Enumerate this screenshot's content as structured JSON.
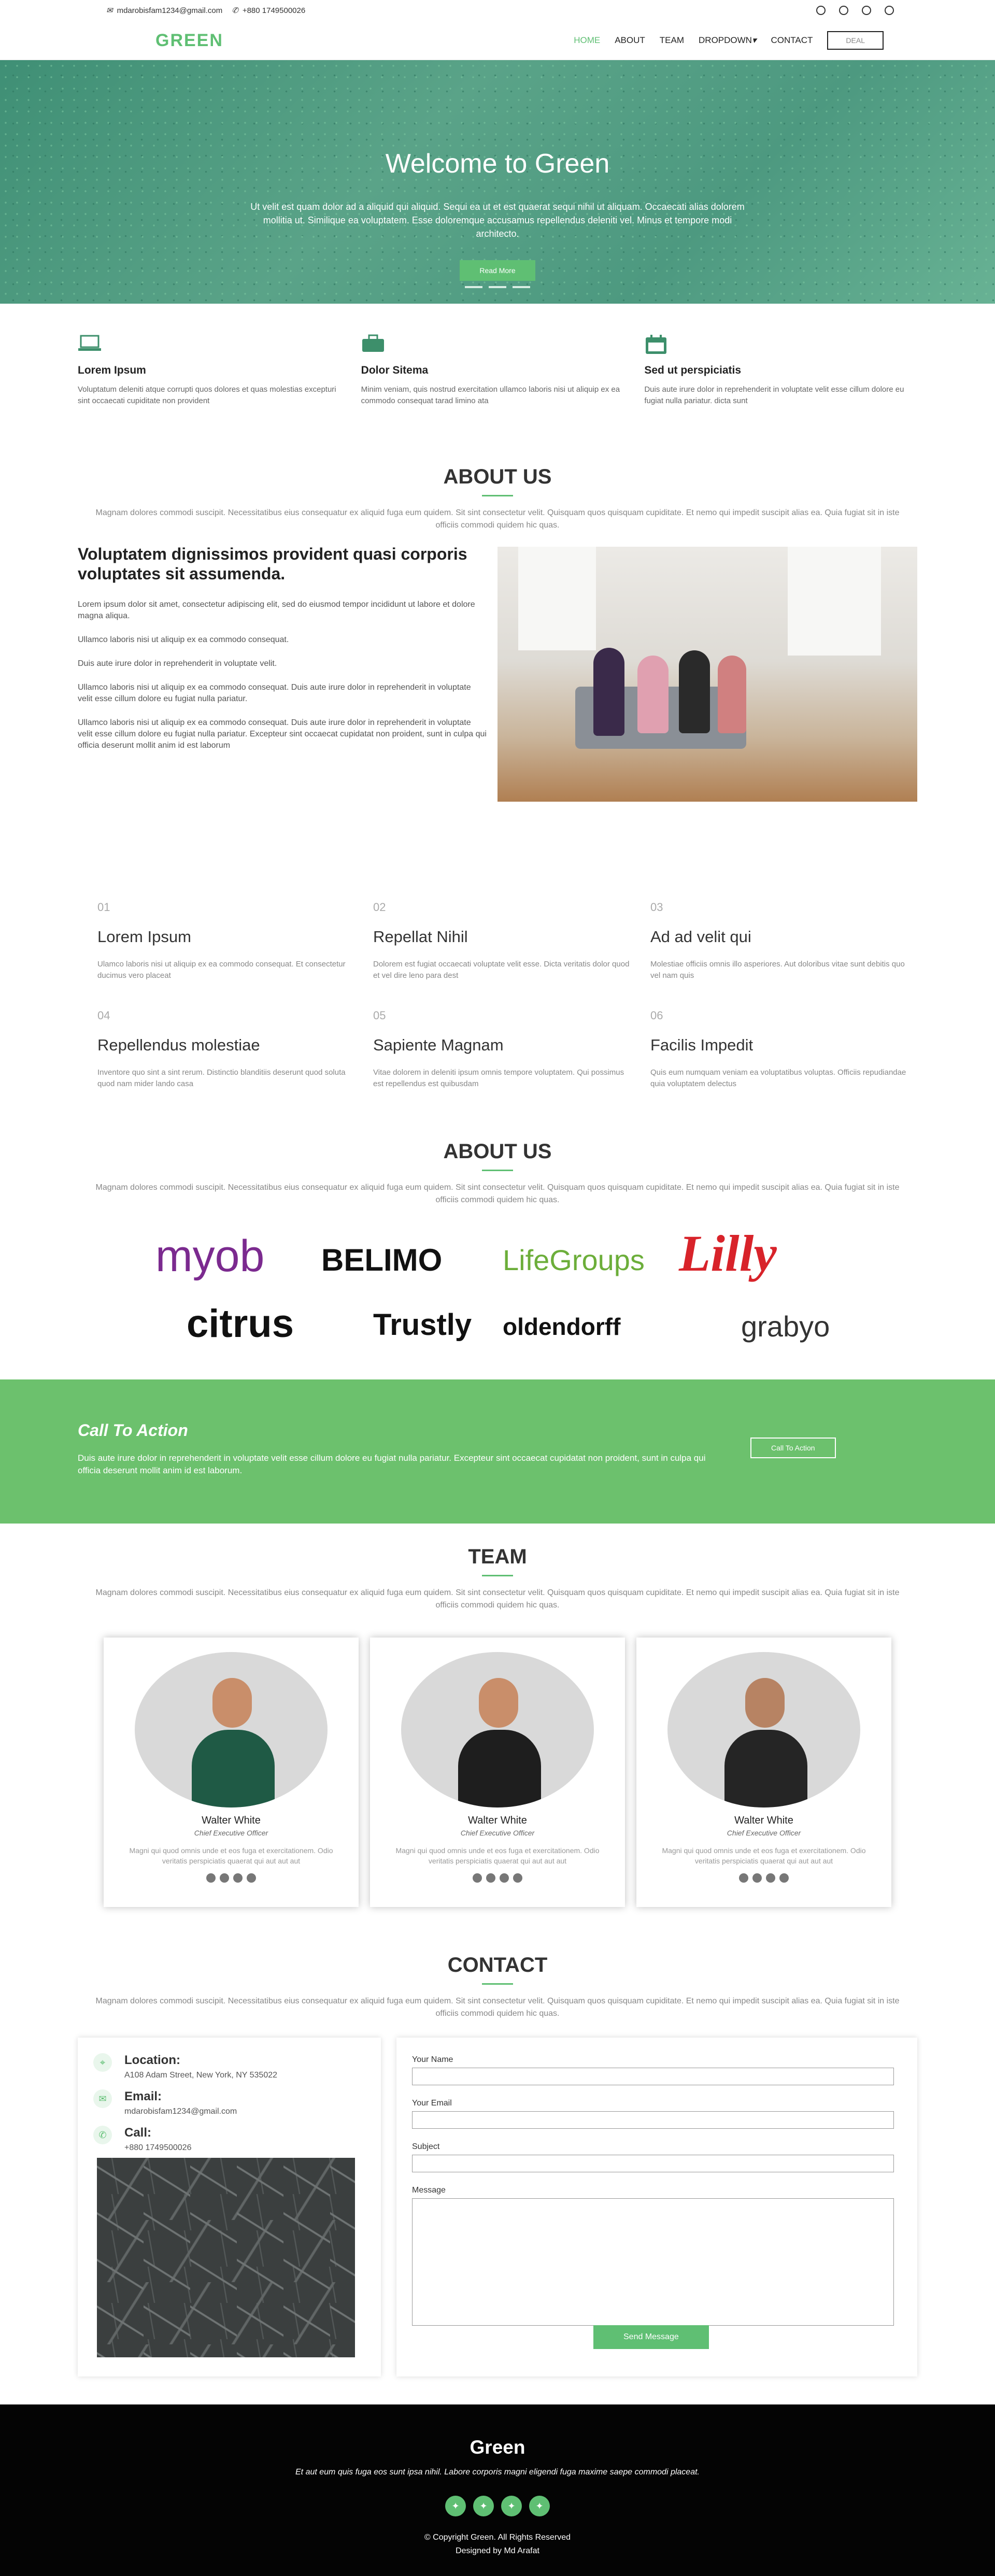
{
  "topbar": {
    "email": "mdarobisfam1234@gmail.com",
    "phone": "+880 1749500026"
  },
  "header": {
    "logo": "GREEN",
    "nav": [
      "HOME",
      "ABOUT",
      "TEAM",
      "DROPDOWN",
      "CONTACT"
    ],
    "dropdown_caret": "▾",
    "button": "DEAL"
  },
  "hero": {
    "title": "Welcome to Green",
    "text": "Ut velit est quam dolor ad a aliquid qui aliquid. Sequi ea ut et est quaerat sequi nihil ut aliquam. Occaecati alias dolorem mollitia ut. Similique ea voluptatem. Esse doloremque accusamus repellendus deleniti vel. Minus et tempore modi architecto.",
    "button": "Read More",
    "slides": 3
  },
  "features": [
    {
      "icon": "laptop-icon",
      "title": "Lorem Ipsum",
      "text": "Voluptatum deleniti atque corrupti quos dolores et quas molestias excepturi sint occaecati cupiditate non provident"
    },
    {
      "icon": "briefcase-icon",
      "title": "Dolor Sitema",
      "text": "Minim veniam, quis nostrud exercitation ullamco laboris nisi ut aliquip ex ea commodo consequat tarad limino ata"
    },
    {
      "icon": "calendar-icon",
      "title": "Sed ut perspiciatis",
      "text": "Duis aute irure dolor in reprehenderit in voluptate velit esse cillum dolore eu fugiat nulla pariatur. dicta sunt"
    }
  ],
  "about": {
    "title": "ABOUT US",
    "subtitle": "Magnam dolores commodi suscipit. Necessitatibus eius consequatur ex aliquid fuga eum quidem. Sit sint consectetur velit. Quisquam quos quisquam cupiditate. Et nemo qui impedit suscipit alias ea. Quia fugiat sit in iste officiis commodi quidem hic quas.",
    "heading": "Voluptatem dignissimos provident quasi corporis voluptates sit assumenda.",
    "paras": [
      "Lorem ipsum dolor sit amet, consectetur adipiscing elit, sed do eiusmod tempor incididunt ut labore et dolore magna aliqua.",
      "Ullamco laboris nisi ut aliquip ex ea commodo consequat.",
      "Duis aute irure dolor in reprehenderit in voluptate velit.",
      "Ullamco laboris nisi ut aliquip ex ea commodo consequat. Duis aute irure dolor in reprehenderit in voluptate velit esse cillum dolore eu fugiat nulla pariatur.",
      "Ullamco laboris nisi ut aliquip ex ea commodo consequat. Duis aute irure dolor in reprehenderit in voluptate velit esse cillum dolore eu fugiat nulla pariatur. Excepteur sint occaecat cupidatat non proident, sunt in culpa qui officia deserunt mollit anim id est laborum"
    ]
  },
  "stats": [
    {
      "n": "01",
      "title": "Lorem Ipsum",
      "text": "Ulamco laboris nisi ut aliquip ex ea commodo consequat. Et consectetur ducimus vero placeat"
    },
    {
      "n": "02",
      "title": "Repellat Nihil",
      "text": "Dolorem est fugiat occaecati voluptate velit esse. Dicta veritatis dolor quod et vel dire leno para dest"
    },
    {
      "n": "03",
      "title": "Ad ad velit qui",
      "text": "Molestiae officiis omnis illo asperiores. Aut doloribus vitae sunt debitis quo vel nam quis"
    },
    {
      "n": "04",
      "title": "Repellendus molestiae",
      "text": "Inventore quo sint a sint rerum. Distinctio blanditiis deserunt quod soluta quod nam mider lando casa"
    },
    {
      "n": "05",
      "title": "Sapiente Magnam",
      "text": "Vitae dolorem in deleniti ipsum omnis tempore voluptatem. Qui possimus est repellendus est quibusdam"
    },
    {
      "n": "06",
      "title": "Facilis Impedit",
      "text": "Quis eum numquam veniam ea voluptatibus voluptas. Officiis repudiandae quia voluptatem delectus"
    }
  ],
  "clients": {
    "title": "ABOUT US",
    "subtitle": "Magnam dolores commodi suscipit. Necessitatibus eius consequatur ex aliquid fuga eum quidem. Sit sint consectetur velit. Quisquam quos quisquam cupiditate. Et nemo qui impedit suscipit alias ea. Quia fugiat sit in iste officiis commodi quidem hic quas.",
    "logos": [
      "myob",
      "BELIMO",
      "LifeGroups",
      "Lilly",
      "citrus",
      "Trustly",
      "oldendorff",
      "grabyo"
    ]
  },
  "cta": {
    "title": "Call To Action",
    "text": "Duis aute irure dolor in reprehenderit in voluptate velit esse cillum dolore eu fugiat nulla pariatur. Excepteur sint occaecat cupidatat non proident, sunt in culpa qui officia deserunt mollit anim id est laborum.",
    "button": "Call To Action"
  },
  "team": {
    "title": "TEAM",
    "subtitle": "Magnam dolores commodi suscipit. Necessitatibus eius consequatur ex aliquid fuga eum quidem. Sit sint consectetur velit. Quisquam quos quisquam cupiditate. Et nemo qui impedit suscipit alias ea. Quia fugiat sit in iste officiis commodi quidem hic quas.",
    "members": [
      {
        "name": "Walter White",
        "role": "Chief Executive Officer",
        "text": "Magni qui quod omnis unde et eos fuga et exercitationem. Odio veritatis perspiciatis quaerat qui aut aut aut",
        "color": "#1f5a45"
      },
      {
        "name": "Walter White",
        "role": "Chief Executive Officer",
        "text": "Magni qui quod omnis unde et eos fuga et exercitationem. Odio veritatis perspiciatis quaerat qui aut aut aut",
        "color": "#1e1e1e"
      },
      {
        "name": "Walter White",
        "role": "Chief Executive Officer",
        "text": "Magni qui quod omnis unde et eos fuga et exercitationem. Odio veritatis perspiciatis quaerat qui aut aut aut",
        "color": "#252525"
      }
    ]
  },
  "contact": {
    "title": "CONTACT",
    "subtitle": "Magnam dolores commodi suscipit. Necessitatibus eius consequatur ex aliquid fuga eum quidem. Sit sint consectetur velit. Quisquam quos quisquam cupiditate. Et nemo qui impedit suscipit alias ea. Quia fugiat sit in iste officiis commodi quidem hic quas.",
    "location_label": "Location:",
    "location": "A108 Adam Street, New York, NY 535022",
    "email_label": "Email:",
    "email": "mdarobisfam1234@gmail.com",
    "call_label": "Call:",
    "call": "+880 1749500026",
    "fields": [
      "Your Name",
      "Your Email",
      "Subject",
      "Message"
    ],
    "send": "Send Message"
  },
  "footer": {
    "brand": "Green",
    "quote": "Et aut eum quis fuga eos sunt ipsa nihil. Labore corporis magni eligendi fuga maxime saepe commodi placeat.",
    "copyright": "© Copyright Green. All Rights Reserved",
    "designed": "Designed by Md Arafat"
  },
  "colors": {
    "accent": "#5fbf73",
    "hero": "#4d9980",
    "cta": "#6cc16d",
    "footer": "#040404"
  }
}
